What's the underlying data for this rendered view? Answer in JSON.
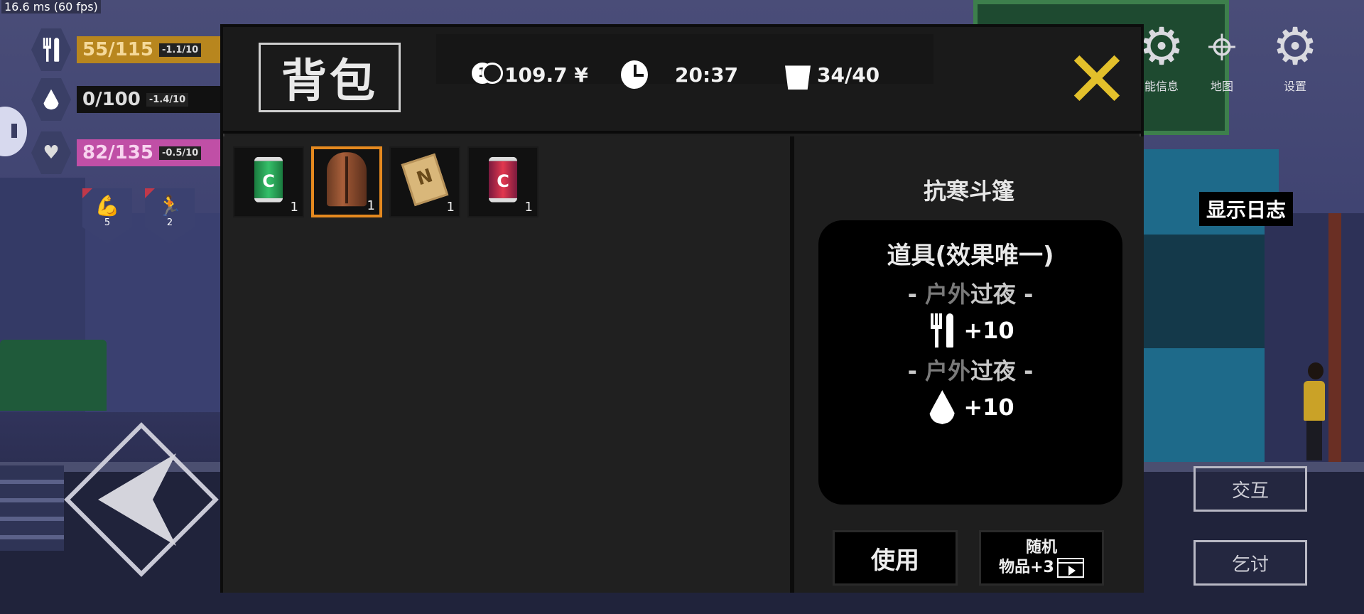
{
  "debug": {
    "fps_text": "16.6 ms (60 fps)"
  },
  "hud": {
    "food": {
      "value": "55/115",
      "rate": "-1.1/10"
    },
    "water": {
      "value": "0/100",
      "rate": "-1.4/10"
    },
    "health": {
      "value": "82/135",
      "rate": "-0.5/10"
    },
    "badges": [
      {
        "icon": "muscle-icon",
        "value": "5"
      },
      {
        "icon": "running-icon",
        "value": "2"
      }
    ],
    "colors": {
      "food": "#b8861e",
      "health": "#c04fa6",
      "accent": "#e5891f",
      "close": "#e3c02b"
    }
  },
  "top_right": {
    "info_label": "能信息",
    "map_label": "地图",
    "settings_label": "设置"
  },
  "log_button": "显示日志",
  "side_buttons": {
    "interact": "交互",
    "beg": "乞讨"
  },
  "inventory": {
    "title": "背包",
    "money": "109.7 ¥",
    "coin_digit": "1",
    "time": "20:37",
    "capacity": "34/40",
    "items": [
      {
        "icon": "green-soda-can-icon",
        "qty": "1",
        "mark": "C",
        "selected": false
      },
      {
        "icon": "brown-cloak-icon",
        "qty": "1",
        "selected": true
      },
      {
        "icon": "paper-note-icon",
        "qty": "1",
        "mark": "N",
        "selected": false
      },
      {
        "icon": "red-soda-can-icon",
        "qty": "1",
        "mark": "C",
        "selected": false
      }
    ],
    "detail": {
      "name": "抗寒斗篷",
      "type": "道具(效果唯一)",
      "effects": [
        {
          "label_dim": "户外",
          "label_bright": "过夜",
          "icon": "fork-knife-icon",
          "value": "+10"
        },
        {
          "label_dim": "户外",
          "label_bright": "过夜",
          "icon": "water-drop-icon",
          "value": "+10"
        }
      ],
      "use_button": "使用",
      "random_button_line1": "随机",
      "random_button_line2": "物品+3"
    }
  }
}
